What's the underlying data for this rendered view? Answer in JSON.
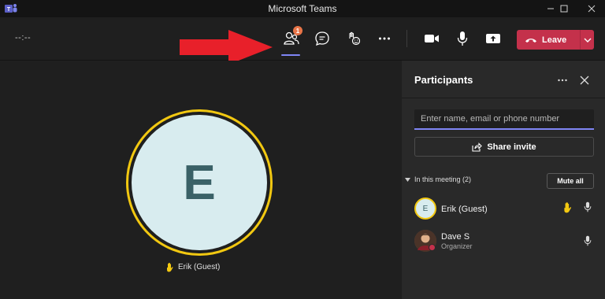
{
  "window": {
    "title": "Microsoft Teams",
    "controls": [
      "minimize-icon",
      "maximize-icon",
      "close-icon"
    ]
  },
  "toolbar": {
    "timer": "--:--",
    "participants_badge": "1",
    "buttons": [
      "participants-icon",
      "chat-icon",
      "reactions-icon",
      "more-icon",
      "camera-icon",
      "microphone-icon",
      "share-screen-icon"
    ],
    "leave_label": "Leave",
    "leave_color": "#c4314b",
    "accent_color": "#7f85f5"
  },
  "stage": {
    "avatar_initial": "E",
    "participant_name": "Erik (Guest)",
    "hand_raised": true,
    "ring_color": "#f2c811"
  },
  "panel": {
    "title": "Participants",
    "search_placeholder": "Enter name, email or phone number",
    "share_invite_label": "Share invite",
    "section_label": "In this meeting (2)",
    "mute_all_label": "Mute all",
    "participants": [
      {
        "initial": "E",
        "name": "Erik (Guest)",
        "role": "",
        "hand_raised": true
      },
      {
        "initial": "",
        "name": "Dave S",
        "role": "Organizer",
        "hand_raised": false
      }
    ]
  }
}
